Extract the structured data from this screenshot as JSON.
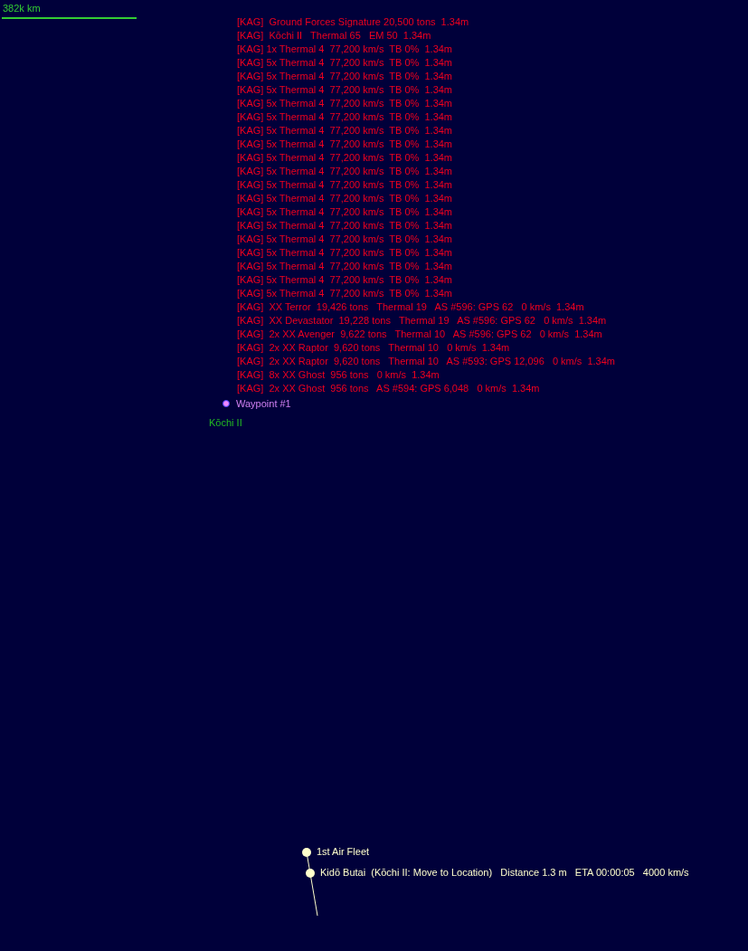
{
  "scale": {
    "label": "382k km"
  },
  "contacts": [
    "[KAG]  Ground Forces Signature 20,500 tons  1.34m",
    "[KAG]  Kōchi II   Thermal 65   EM 50  1.34m",
    "[KAG] 1x Thermal 4  77,200 km/s  TB 0%  1.34m",
    "[KAG] 5x Thermal 4  77,200 km/s  TB 0%  1.34m",
    "[KAG] 5x Thermal 4  77,200 km/s  TB 0%  1.34m",
    "[KAG] 5x Thermal 4  77,200 km/s  TB 0%  1.34m",
    "[KAG] 5x Thermal 4  77,200 km/s  TB 0%  1.34m",
    "[KAG] 5x Thermal 4  77,200 km/s  TB 0%  1.34m",
    "[KAG] 5x Thermal 4  77,200 km/s  TB 0%  1.34m",
    "[KAG] 5x Thermal 4  77,200 km/s  TB 0%  1.34m",
    "[KAG] 5x Thermal 4  77,200 km/s  TB 0%  1.34m",
    "[KAG] 5x Thermal 4  77,200 km/s  TB 0%  1.34m",
    "[KAG] 5x Thermal 4  77,200 km/s  TB 0%  1.34m",
    "[KAG] 5x Thermal 4  77,200 km/s  TB 0%  1.34m",
    "[KAG] 5x Thermal 4  77,200 km/s  TB 0%  1.34m",
    "[KAG] 5x Thermal 4  77,200 km/s  TB 0%  1.34m",
    "[KAG] 5x Thermal 4  77,200 km/s  TB 0%  1.34m",
    "[KAG] 5x Thermal 4  77,200 km/s  TB 0%  1.34m",
    "[KAG] 5x Thermal 4  77,200 km/s  TB 0%  1.34m",
    "[KAG] 5x Thermal 4  77,200 km/s  TB 0%  1.34m",
    "[KAG] 5x Thermal 4  77,200 km/s  TB 0%  1.34m",
    "[KAG]  XX Terror  19,426 tons   Thermal 19   AS #596: GPS 62   0 km/s  1.34m",
    "[KAG]  XX Devastator  19,228 tons   Thermal 19   AS #596: GPS 62   0 km/s  1.34m",
    "[KAG]  2x XX Avenger  9,622 tons   Thermal 10   AS #596: GPS 62   0 km/s  1.34m",
    "[KAG]  2x XX Raptor  9,620 tons   Thermal 10   0 km/s  1.34m",
    "[KAG]  2x XX Raptor  9,620 tons   Thermal 10   AS #593: GPS 12,096   0 km/s  1.34m",
    "[KAG]  8x XX Ghost  956 tons   0 km/s  1.34m",
    "[KAG]  2x XX Ghost  956 tons   AS #594: GPS 6,048   0 km/s  1.34m"
  ],
  "waypoint": {
    "label": "Waypoint #1"
  },
  "body": {
    "label": "Kōchi II"
  },
  "fleets": [
    {
      "label": "1st Air Fleet"
    },
    {
      "label": "Kidō Butai  (Kōchi II: Move to Location)   Distance 1.3 m   ETA 00:00:05   4000 km/s"
    }
  ]
}
